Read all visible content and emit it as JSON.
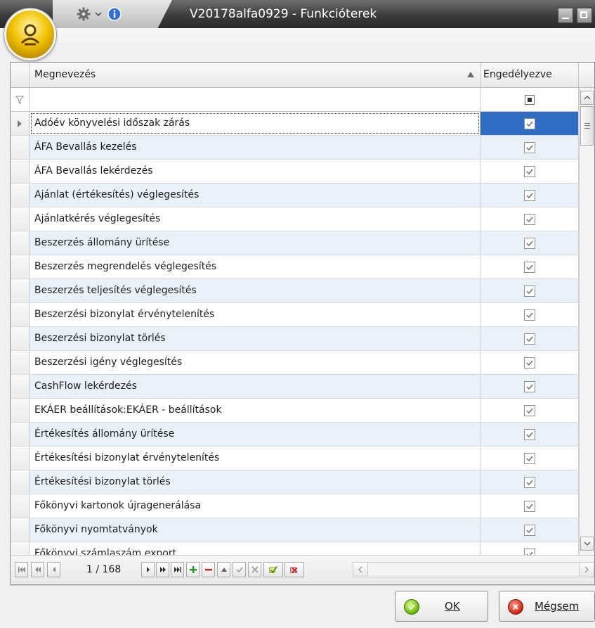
{
  "window": {
    "title": "V20178alfa0929 - Funkcióterek"
  },
  "icons": {
    "app": "app-orb-icon",
    "quick_access": [
      "gear-icon",
      "chevron-down-icon",
      "info-icon"
    ]
  },
  "grid": {
    "columns": {
      "name": "Megnevezés",
      "allowed": "Engedélyezve"
    },
    "rows": [
      {
        "name": "Adóév könyvelési időszak zárás",
        "allowed": true
      },
      {
        "name": "ÁFA Bevallás kezelés",
        "allowed": true
      },
      {
        "name": "ÁFA Bevallás lekérdezés",
        "allowed": true
      },
      {
        "name": "Ajánlat (értékesítés) véglegesítés",
        "allowed": true
      },
      {
        "name": "Ajánlatkérés véglegesítés",
        "allowed": true
      },
      {
        "name": "Beszerzés állomány ürítése",
        "allowed": true
      },
      {
        "name": "Beszerzés megrendelés véglegesítés",
        "allowed": true
      },
      {
        "name": "Beszerzés teljesítés véglegesítés",
        "allowed": true
      },
      {
        "name": "Beszerzési bizonylat érvénytelenítés",
        "allowed": true
      },
      {
        "name": "Beszerzési bizonylat törlés",
        "allowed": true
      },
      {
        "name": "Beszerzési igény véglegesítés",
        "allowed": true
      },
      {
        "name": "CashFlow lekérdezés",
        "allowed": true
      },
      {
        "name": "EKÁER beállítások:EKÁER - beállítások",
        "allowed": true
      },
      {
        "name": "Értékesítés állomány ürítése",
        "allowed": true
      },
      {
        "name": "Értékesítési bizonylat érvénytelenítés",
        "allowed": true
      },
      {
        "name": "Értékesítési bizonylat törlés",
        "allowed": true
      },
      {
        "name": "Főkönyvi kartonok újragenerálása",
        "allowed": true
      },
      {
        "name": "Főkönyvi nyomtatványok",
        "allowed": true
      },
      {
        "name": "Főkönyvi számlaszám export",
        "allowed": true
      }
    ],
    "focused_row": 0
  },
  "navigator": {
    "page_info": "1 / 168"
  },
  "buttons": {
    "ok": "OK",
    "cancel": "Mégsem"
  },
  "colors": {
    "selection": "#2f6cc2",
    "alt_row": "#eaf1f9",
    "title_bar": "#3c3c3c"
  }
}
